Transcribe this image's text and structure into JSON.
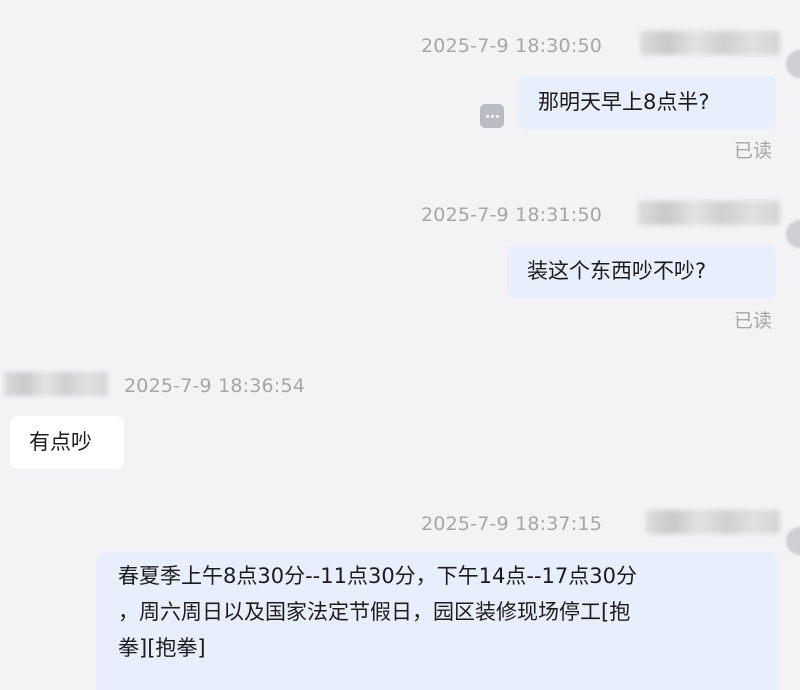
{
  "messages": [
    {
      "direction": "outgoing",
      "timestamp": "2025-7-9 18:30:50",
      "text": "那明天早上8点半?",
      "read_status": "已读",
      "has_more_button": true
    },
    {
      "direction": "outgoing",
      "timestamp": "2025-7-9 18:31:50",
      "text": "装这个东西吵不吵?",
      "read_status": "已读"
    },
    {
      "direction": "incoming",
      "timestamp": "2025-7-9 18:36:54",
      "text": "有点吵"
    },
    {
      "direction": "outgoing",
      "timestamp": "2025-7-9 18:37:15",
      "text_lines": [
        "春夏季上午8点30分--11点30分，下午14点--17点30分",
        "，周六周日以及国家法定节假日，园区装修现场停工[抱",
        "拳][抱拳]"
      ]
    }
  ],
  "colors": {
    "background": "#f3f3f5",
    "outgoing_bubble": "#e8eefc",
    "incoming_bubble": "#ffffff",
    "meta_text": "#a6a6a6",
    "message_text": "#1c1c1c"
  },
  "icons": {
    "more": "ellipsis-icon"
  }
}
